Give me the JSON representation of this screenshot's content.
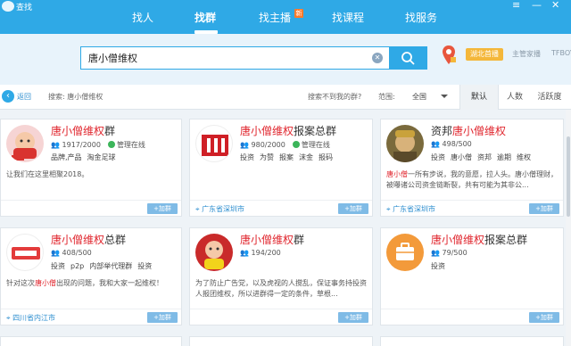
{
  "app": {
    "title": "查找"
  },
  "nav": {
    "items": [
      {
        "label": "找人"
      },
      {
        "label": "找群"
      },
      {
        "label": "找主播"
      },
      {
        "label": "找课程"
      },
      {
        "label": "找服务"
      }
    ],
    "new_badge": "新"
  },
  "search": {
    "query": "唐小僧维权"
  },
  "header": {
    "region_badge": "湖北首播",
    "link1": "主管家播",
    "link2": "TFBOY"
  },
  "filter": {
    "back_label": "返回",
    "summary": "搜索: 唐小僧维权",
    "feedback": "搜索不到我的群?",
    "range_label": "范围:",
    "range_value": "全国",
    "tabs": [
      "默认",
      "人数",
      "活跃度"
    ]
  },
  "results": [
    {
      "title_hl": "唐小僧维权",
      "title_rest": "群",
      "members": "1917/2000",
      "status": "管理在线",
      "tags": [
        "品牌,产品",
        "淘金足球"
      ],
      "desc_pre": "让我们在这里相聚2018。",
      "desc_hl": "",
      "desc_post": "",
      "location": "",
      "join": "+加群"
    },
    {
      "title_hl": "唐小僧维权",
      "title_rest": "报案总群",
      "members": "980/2000",
      "status": "管理在线",
      "tags": [
        "投资",
        "为赞",
        "报案",
        "沫金",
        "报码"
      ],
      "desc_pre": "",
      "desc_hl": "",
      "desc_post": "",
      "location": "广东省深圳市",
      "join": "+加群"
    },
    {
      "title_pre": "资邦",
      "title_hl": "唐小僧维权",
      "title_rest": "",
      "members": "498/500",
      "status": "",
      "tags": [
        "投资",
        "唐小僧",
        "资邦",
        "逾期",
        "维权"
      ],
      "desc_pre": "",
      "desc_hl": "唐小僧",
      "desc_post": "一所有步说，我的意愿，拉人头。唐小僧理财，被曝诸公司资金链断裂，共有可能为其非公...",
      "location": "广东省深圳市",
      "join": "+加群"
    },
    {
      "title_hl": "唐小僧维权",
      "title_rest": "总群",
      "members": "408/500",
      "status": "",
      "tags": [
        "投资",
        "p2p",
        "内部举代理群",
        "投资"
      ],
      "desc_pre": "针对这次",
      "desc_hl": "唐小僧",
      "desc_post": "出现的问题，我和大家一起维权！",
      "location": "四川省内江市",
      "join": "+加群"
    },
    {
      "title_hl": "唐小僧维权",
      "title_rest": "群",
      "members": "194/200",
      "status": "",
      "tags": [],
      "desc_pre": "为了防止广告党，以及虎视的人搅乱，保证事务持投资人报团维权，所以进群得一定的条件，草根...",
      "desc_hl": "",
      "desc_post": "",
      "location": "",
      "join": "+加群"
    },
    {
      "title_hl": "唐小僧维权",
      "title_rest": "报案总群",
      "members": "79/500",
      "status": "",
      "tags": [
        "投资"
      ],
      "desc_pre": "",
      "desc_hl": "",
      "desc_post": "",
      "location": "",
      "join": "+加群"
    }
  ]
}
